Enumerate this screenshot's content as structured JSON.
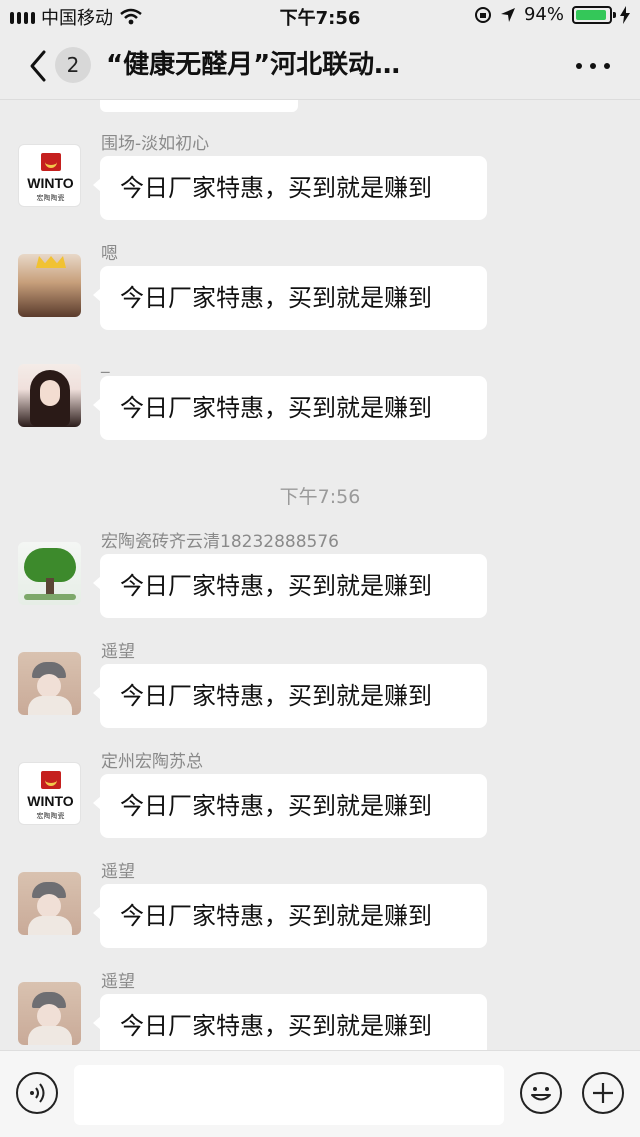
{
  "status_bar": {
    "carrier": "中国移动",
    "time": "下午7:56",
    "battery_percent": "94%",
    "battery_level": 0.94,
    "icons": [
      "signal-icon",
      "wifi-icon",
      "orientation-lock-icon",
      "location-icon",
      "battery-icon",
      "charging-icon"
    ]
  },
  "nav": {
    "back_badge_count": "2",
    "title": "“健康无醛月”河北联动…",
    "icons": [
      "back-chevron-icon",
      "more-icon"
    ]
  },
  "chat": {
    "timestamp": "下午7:56",
    "messages": [
      {
        "sender": "围场-淡如初心",
        "text": "今日厂家特惠，买到就是赚到",
        "avatar": "winto-logo"
      },
      {
        "sender": "嗯",
        "text": "今日厂家特惠，买到就是赚到",
        "avatar": "photo-crown"
      },
      {
        "sender": "_",
        "text": "今日厂家特惠，买到就是赚到",
        "avatar": "photo-girl"
      },
      {
        "sender": "宏陶瓷砖齐云清18232888576",
        "text": "今日厂家特惠，买到就是赚到",
        "avatar": "tree"
      },
      {
        "sender": "遥望",
        "text": "今日厂家特惠，买到就是赚到",
        "avatar": "photo-cap"
      },
      {
        "sender": "定州宏陶苏总",
        "text": "今日厂家特惠，买到就是赚到",
        "avatar": "winto-logo"
      },
      {
        "sender": "遥望",
        "text": "今日厂家特惠，买到就是赚到",
        "avatar": "photo-cap"
      },
      {
        "sender": "遥望",
        "text": "今日厂家特惠，买到就是赚到",
        "avatar": "photo-cap"
      }
    ]
  },
  "winto_logo": {
    "text": "WINTO",
    "sub": "宏陶陶瓷"
  },
  "toolbar": {
    "input_value": "",
    "icons": [
      "voice-icon",
      "emoji-icon",
      "plus-icon"
    ]
  },
  "colors": {
    "background": "#ececec",
    "bubble": "#ffffff",
    "battery_fill": "#34c759",
    "sender_text": "#8a8a8a"
  }
}
